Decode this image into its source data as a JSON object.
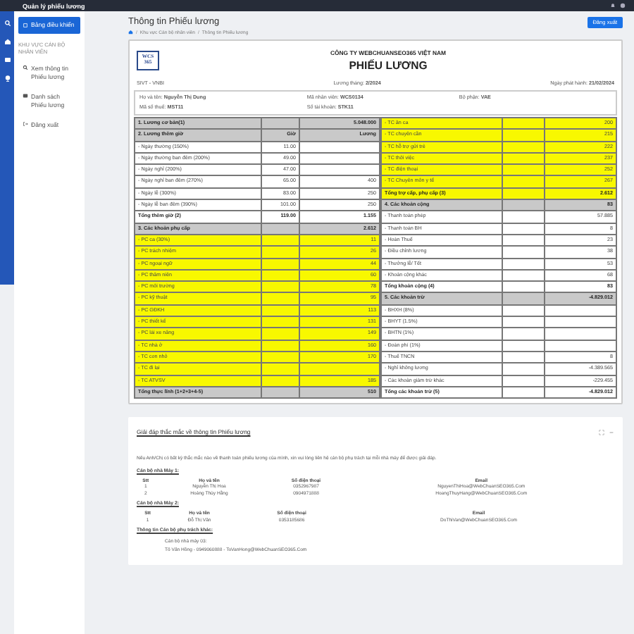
{
  "top_bar": {
    "title": "Quản lý phiếu lương"
  },
  "sidebar": {
    "items": [
      {
        "kind": "link",
        "label": "Bảng điều khiển",
        "selected": true
      },
      {
        "kind": "heading",
        "label": "KHU VỰC CÁN BỘ NHÂN VIÊN"
      },
      {
        "kind": "link",
        "label": "Xem thông tin Phiếu lương",
        "selected": false
      },
      {
        "kind": "link",
        "label": "Danh sách Phiếu lương",
        "selected": false
      },
      {
        "kind": "link",
        "label": "Đăng xuất",
        "selected": false
      }
    ]
  },
  "header": {
    "title": "Thông tin Phiếu lương",
    "separator": "/",
    "breadcrumb": [
      "Khu vực Cán bộ nhân viên",
      "Thông tin Phiếu lương"
    ],
    "button": "Đăng xuất"
  },
  "payslip": {
    "logo": [
      "WCS",
      "365"
    ],
    "company": "CÔNG TY WEBCHUANSEO365 VIỆT NAM",
    "title": "PHIẾU LƯƠNG",
    "code": "SIVT - VNBI",
    "month_label": "Lương tháng:",
    "month": "2/2024",
    "issue_label": "Ngày phát hành:",
    "issue_date": "21/02/2024",
    "employee": [
      {
        "label": "Họ và tên:",
        "value": "Nguyễn Thị Dung"
      },
      {
        "label": "Mã nhân viên:",
        "value": "WCS0134"
      },
      {
        "label": "Bộ phận:",
        "value": "VAE"
      },
      {
        "label": "Mã số thuế:",
        "value": "MST11"
      },
      {
        "label": "Số tài khoản:",
        "value": "STK11"
      }
    ],
    "left_table": [
      {
        "kind": "section",
        "label": "1. Lương cơ bản(1)",
        "amount": "5.048.000"
      },
      {
        "kind": "section",
        "label": "2. Lương thêm giờ",
        "hours": "Giờ",
        "amount": "Lương"
      },
      {
        "kind": "item",
        "label": "- Ngày thường (150%)",
        "hours": "11.00"
      },
      {
        "kind": "item",
        "label": "- Ngày thường ban đêm (200%)",
        "hours": "49.00"
      },
      {
        "kind": "item",
        "label": "- Ngày nghỉ (200%)",
        "hours": "47.00"
      },
      {
        "kind": "item",
        "label": "- Ngày nghỉ ban đêm (270%)",
        "hours": "65.00",
        "amount": "400"
      },
      {
        "kind": "item",
        "label": "- Ngày lễ (300%)",
        "hours": "83.00",
        "amount": "250"
      },
      {
        "kind": "item",
        "label": "- Ngày lễ ban đêm (390%)",
        "hours": "101.00",
        "amount": "250"
      },
      {
        "kind": "total",
        "label": "Tổng thêm giờ (2)",
        "hours": "119.00",
        "amount": "1.155"
      },
      {
        "kind": "section",
        "label": "3. Các khoản phụ cấp",
        "amount": "2.612"
      },
      {
        "kind": "highlight",
        "label": "- PC ca (30%)",
        "amount": "11"
      },
      {
        "kind": "highlight",
        "label": "- PC trách nhiệm",
        "amount": "26"
      },
      {
        "kind": "highlight",
        "label": "- PC ngoại ngữ",
        "amount": "44"
      },
      {
        "kind": "highlight",
        "label": "- PC thâm niên",
        "amount": "60"
      },
      {
        "kind": "highlight",
        "label": "- PC môi trường",
        "amount": "78"
      },
      {
        "kind": "highlight",
        "label": "- PC kỹ thuật",
        "amount": "95"
      },
      {
        "kind": "highlight",
        "label": "- PC GĐKH",
        "amount": "113"
      },
      {
        "kind": "highlight",
        "label": "- PC thiết kế",
        "amount": "131"
      },
      {
        "kind": "highlight",
        "label": "- PC lái xe nâng",
        "amount": "149"
      },
      {
        "kind": "highlight",
        "label": "- TC nhà ở",
        "amount": "160"
      },
      {
        "kind": "highlight",
        "label": "- TC con nhỏ",
        "amount": "170"
      },
      {
        "kind": "highlight",
        "label": "- TC đi lại"
      },
      {
        "kind": "highlight",
        "label": "- TC ATVSV",
        "amount": "185"
      },
      {
        "kind": "section",
        "label": "Tổng thực lĩnh (1+2+3+4-5)",
        "amount": "510"
      }
    ],
    "right_table": [
      {
        "kind": "highlight",
        "label": "- TC ăn ca",
        "amount": "200"
      },
      {
        "kind": "highlight",
        "label": "- TC chuyên cần",
        "amount": "215"
      },
      {
        "kind": "highlight",
        "label": "- TC hỗ trợ gửi trẻ",
        "amount": "222"
      },
      {
        "kind": "highlight",
        "label": "- TC thôi việc",
        "amount": "237"
      },
      {
        "kind": "highlight",
        "label": "- TC điện thoại",
        "amount": "252"
      },
      {
        "kind": "highlight",
        "label": "- TC Chuyên môn y tế",
        "amount": "267"
      },
      {
        "kind": "highlight_total",
        "label": "Tổng trợ cấp, phụ cấp (3)",
        "amount": "2.612"
      },
      {
        "kind": "section",
        "label": "4. Các khoản cộng",
        "amount": "83"
      },
      {
        "kind": "item",
        "label": "- Thanh toán phép",
        "amount": "57.885"
      },
      {
        "kind": "item",
        "label": "- Thanh toán BH",
        "amount": "8"
      },
      {
        "kind": "item",
        "label": "- Hoàn Thuế",
        "amount": "23"
      },
      {
        "kind": "item",
        "label": "- Điều chỉnh lương",
        "amount": "38"
      },
      {
        "kind": "item",
        "label": "- Thưởng lễ/ Tết",
        "amount": "53"
      },
      {
        "kind": "item",
        "label": "- Khoản cộng khác",
        "amount": "68"
      },
      {
        "kind": "total",
        "label": "Tổng khoản cộng (4)",
        "amount": "83"
      },
      {
        "kind": "section",
        "label": "5. Các khoản trừ",
        "amount": "-4.829.012"
      },
      {
        "kind": "item",
        "label": "- BHXH (8%)"
      },
      {
        "kind": "item",
        "label": "- BHYT (1.5%)"
      },
      {
        "kind": "item",
        "label": "- BHTN (1%)"
      },
      {
        "kind": "item",
        "label": "- Đoàn phí (1%)"
      },
      {
        "kind": "item",
        "label": "- Thuế TNCN",
        "amount": "8"
      },
      {
        "kind": "item",
        "label": "- Nghỉ không lương",
        "amount": "-4.389.565"
      },
      {
        "kind": "item",
        "label": "- Các khoản giảm trừ khác",
        "amount": "-229.455"
      },
      {
        "kind": "total",
        "label": "Tổng các khoản trừ (5)",
        "amount": "-4.829.012"
      }
    ]
  },
  "faq": {
    "title": "Giải đáp thắc mắc về thông tin Phiếu lương",
    "intro": "Nếu Anh/Chị có bất kỳ thắc mắc nào về thanh toán phiếu lương của mình, xin vui lòng liên hệ cán bộ phụ trách tại mỗi nhà máy để được giải đáp.",
    "groups": [
      {
        "title": "Cán bộ nhà Máy 1:",
        "columns": [
          "Stt",
          "Họ và tên",
          "Số điện thoại",
          "Email"
        ],
        "rows": [
          [
            "1",
            "Nguyễn Thị Hoa",
            "0352967987",
            "NguyenThiHoa@WebChuanSEO365.Com"
          ],
          [
            "2",
            "Hoàng Thùy Hằng",
            "0904971888",
            "HoangThuyHang@WebChuanSEO365.Com"
          ]
        ]
      },
      {
        "title": "Cán bộ nhà Máy 2:",
        "columns": [
          "Stt",
          "Họ và tên",
          "Số điện thoại",
          "Email"
        ],
        "rows": [
          [
            "1",
            "Đỗ Thị Vân",
            "0353185686",
            "DoThiVan@WebChuanSEO365.Com"
          ]
        ]
      }
    ],
    "other": {
      "title": "Thông tin Cán bộ phụ trách khác:",
      "lines": [
        "Cán bộ nhà máy 03:",
        "Tô Văn Hồng - 0949060888 - ToVanHong@WebChuanSEO365.Com"
      ]
    }
  }
}
